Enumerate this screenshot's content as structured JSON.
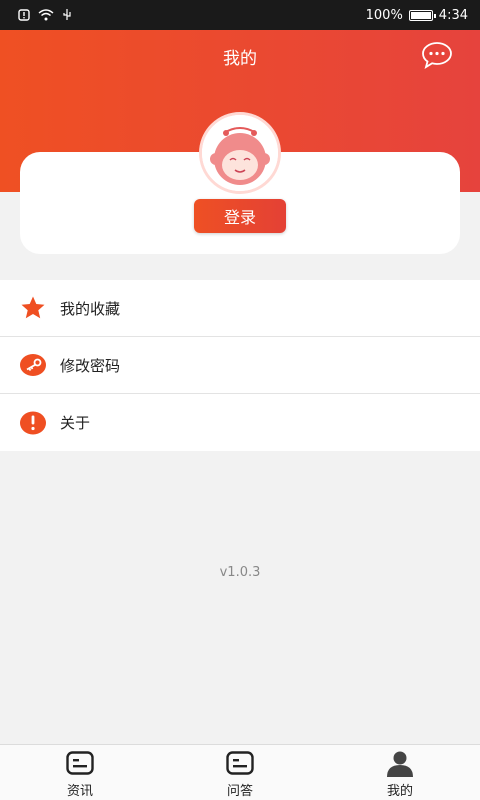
{
  "status_bar": {
    "battery_percent": "100%",
    "time": "4:34"
  },
  "header": {
    "title": "我的"
  },
  "profile": {
    "login_label": "登录"
  },
  "menu": {
    "items": [
      {
        "label": "我的收藏",
        "icon": "star-icon"
      },
      {
        "label": "修改密码",
        "icon": "key-icon"
      },
      {
        "label": "关于",
        "icon": "info-icon"
      }
    ]
  },
  "version": "v1.0.3",
  "tabs": [
    {
      "label": "资讯",
      "icon": "news-icon"
    },
    {
      "label": "问答",
      "icon": "qa-icon"
    },
    {
      "label": "我的",
      "icon": "user-icon"
    }
  ],
  "colors": {
    "accent": "#ef5023",
    "accent_end": "#e6433d"
  }
}
